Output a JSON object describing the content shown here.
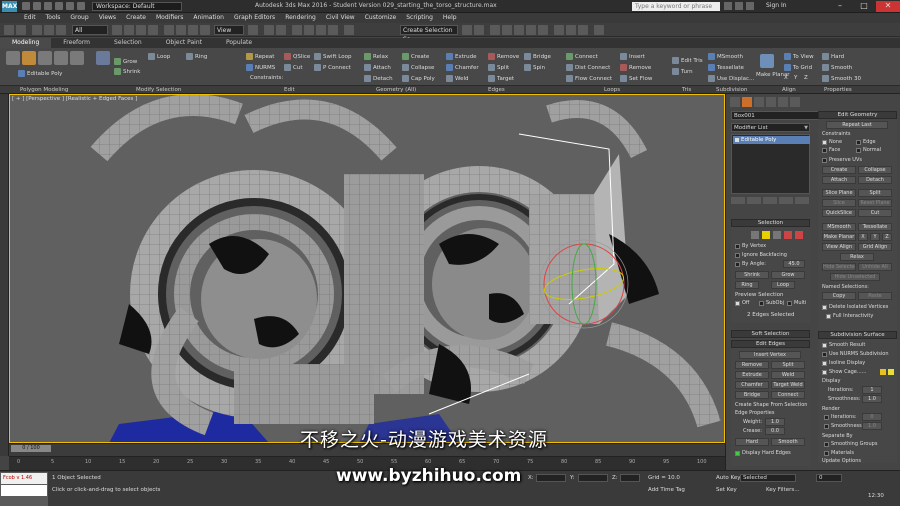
{
  "app": {
    "workspace": "Workspace: Default",
    "window_title": "Autodesk 3ds Max 2016 - Student Version   029_starting_the_torso_structure.max",
    "search_placeholder": "Type a keyword or phrase",
    "sign_in": "Sign In"
  },
  "menu": [
    "Edit",
    "Tools",
    "Group",
    "Views",
    "Create",
    "Modifiers",
    "Animation",
    "Graph Editors",
    "Rendering",
    "Civil View",
    "Customize",
    "Scripting",
    "Help"
  ],
  "main_toolbar": {
    "filter": "All",
    "view": "View",
    "named_set": "Create Selection Se"
  },
  "ribbon": {
    "tabs": [
      "Modeling",
      "Freeform",
      "Selection",
      "Object Paint",
      "Populate"
    ],
    "active_tab": "Modeling",
    "polygon_modeling": {
      "editable_poly": "Editable Poly",
      "label": "Polygon Modeling"
    },
    "modify_selection": {
      "grow": "Grow",
      "shrink": "Shrink",
      "loop": "Loop",
      "ring": "Ring",
      "label": "Modify Selection"
    },
    "edit": {
      "repeat": "Repeat",
      "qslice": "QSlice",
      "swift_loop": "Swift Loop",
      "nurms": "NURMS",
      "cut": "Cut",
      "p_connect": "P Connect",
      "constraints": "Constraints:",
      "label": "Edit"
    },
    "geometry": {
      "relax": "Relax",
      "create": "Create",
      "attach": "Attach",
      "collapse": "Collapse",
      "detach": "Detach",
      "cap_poly": "Cap Poly",
      "label": "Geometry (All)"
    },
    "edges": {
      "extrude": "Extrude",
      "remove": "Remove",
      "bridge": "Bridge",
      "chamfer": "Chamfer",
      "split": "Split",
      "spin": "Spin",
      "weld": "Weld",
      "target": "Target",
      "label": "Edges"
    },
    "loops": {
      "connect": "Connect",
      "insert": "Insert",
      "dist_connect": "Dist Connect",
      "remove": "Remove",
      "flow_connect": "Flow Connect",
      "set_flow": "Set Flow",
      "label": "Loops"
    },
    "tris": {
      "edit_tris": "Edit Tris",
      "turn": "Turn",
      "label": "Tris"
    },
    "subdivision": {
      "msmooth": "MSmooth",
      "tessellate": "Tessellate",
      "use_displace": "Use Displac...",
      "label": "Subdivision"
    },
    "align": {
      "make_planar": "Make Planar",
      "to_view": "To View",
      "to_grid": "To Grid",
      "x": "X",
      "y": "Y",
      "z": "Z",
      "label": "Align"
    },
    "properties": {
      "hard": "Hard",
      "smooth": "Smooth",
      "smooth30": "Smooth 30",
      "label": "Properties"
    }
  },
  "viewport": {
    "label": "[ + ] [Perspective ] [Realistic + Edged Faces ]"
  },
  "timeline": {
    "slider": "0 / 100",
    "ticks": [
      "0",
      "5",
      "10",
      "15",
      "20",
      "25",
      "30",
      "35",
      "40",
      "45",
      "50",
      "55",
      "60",
      "65",
      "70",
      "75",
      "80",
      "85",
      "90",
      "95",
      "100"
    ]
  },
  "status": {
    "maxscript_top": "Fcob v 1.46",
    "maxscript_bottom": "",
    "objects_selected": "1 Object Selected",
    "prompt": "Click or click-and-drag to select objects",
    "x_label": "X:",
    "y_label": "Y:",
    "z_label": "Z:",
    "grid": "Grid = 10.0",
    "add_time_tag": "Add Time Tag",
    "auto_key": "Auto Key",
    "selected": "Selected",
    "set_key": "Set Key",
    "key_filters": "Key Filters...",
    "frame": "0",
    "time": "12:30"
  },
  "command_panel": {
    "object_name": "Box001",
    "modifier_list": "Modifier List",
    "stack_item": "Editable Poly",
    "selection": {
      "title": "Selection",
      "by_vertex": "By Vertex",
      "ignore_backfacing": "Ignore Backfacing",
      "by_angle": "By Angle:",
      "angle_value": "45.0",
      "shrink": "Shrink",
      "grow": "Grow",
      "ring": "Ring",
      "loop": "Loop",
      "preview_selection": "Preview Selection",
      "off": "Off",
      "subobj": "SubObj",
      "multi": "Multi",
      "status": "2 Edges Selected"
    },
    "soft_selection": {
      "title": "Soft Selection"
    },
    "edit_edges": {
      "title": "Edit Edges",
      "insert_vertex": "Insert Vertex",
      "remove": "Remove",
      "split": "Split",
      "extrude": "Extrude",
      "weld": "Weld",
      "chamfer": "Chamfer",
      "target_weld": "Target Weld",
      "bridge": "Bridge",
      "connect": "Connect",
      "create_shape": "Create Shape From Selection",
      "edge_properties": "Edge Properties",
      "weight_label": "Weight:",
      "weight_value": "1.0",
      "crease_label": "Crease:",
      "crease_value": "0.0",
      "hard": "Hard",
      "smooth": "Smooth",
      "display_hard_edges": "Display Hard Edges"
    },
    "edit_geometry": {
      "title": "Edit Geometry",
      "repeat_last": "Repeat Last",
      "constraints": "Constraints",
      "none": "None",
      "edge": "Edge",
      "face": "Face",
      "normal": "Normal",
      "preserve_uvs": "Preserve UVs",
      "create": "Create",
      "collapse": "Collapse",
      "attach": "Attach",
      "detach": "Detach",
      "slice_plane": "Slice Plane",
      "split": "Split",
      "slice": "Slice",
      "reset_plane": "Reset Plane",
      "quickslice": "QuickSlice",
      "cut": "Cut",
      "msmooth": "MSmooth",
      "tessellate": "Tessellate",
      "make_planar": "Make Planar",
      "x": "X",
      "y": "Y",
      "z": "Z",
      "view_align": "View Align",
      "grid_align": "Grid Align",
      "relax": "Relax",
      "hide_selected": "Hide Selected",
      "unhide_all": "Unhide All",
      "hide_unselected": "Hide Unselected",
      "named_selections": "Named Selections:",
      "copy": "Copy",
      "paste": "Paste",
      "delete_isolated": "Delete Isolated Vertices",
      "full_interactivity": "Full Interactivity"
    },
    "subdivision_surface": {
      "title": "Subdivision Surface",
      "smooth_result": "Smooth Result",
      "use_nurms": "Use NURMS Subdivision",
      "isoline_display": "Isoline Display",
      "show_cage": "Show Cage......",
      "display": "Display",
      "iterations_label": "Iterations:",
      "iterations_value": "1",
      "smoothness_label": "Smoothness:",
      "smoothness_value": "1.0",
      "render": "Render",
      "r_iterations_value": "0",
      "r_smoothness_value": "1.0",
      "separate_by": "Separate By",
      "smoothing_groups": "Smoothing Groups",
      "materials": "Materials",
      "update_options": "Update Options"
    }
  },
  "watermark": {
    "line1": "不移之火-动漫游戏美术资源",
    "line2": "www.byzhihuo.com"
  },
  "colors": {
    "accent": "#cc6f2a",
    "selection_blue": "#5a7fb5",
    "viewport_bg": "#5f5f5f",
    "active_border": "#f0c000"
  }
}
